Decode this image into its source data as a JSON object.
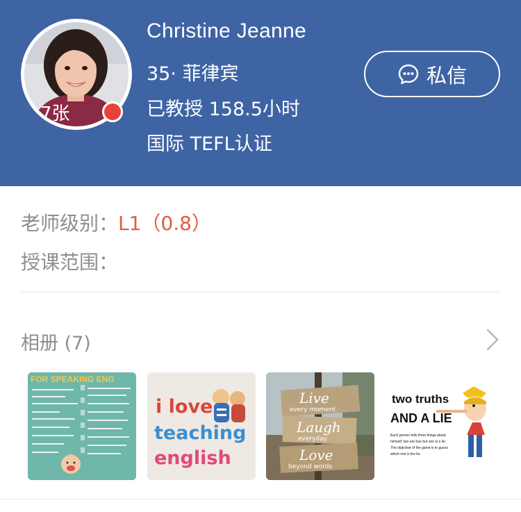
{
  "profile": {
    "name": "Christine Jeanne",
    "photo_count": "7张",
    "age_country": "35· 菲律宾",
    "hours_taught": "已教授 158.5小时",
    "certification": "国际 TEFL认证",
    "message_button": "私信"
  },
  "details": {
    "level_label": "老师级别：",
    "level_value": "L1（0.8）",
    "scope_label": "授课范围："
  },
  "album": {
    "title": "相册 (7)",
    "photos": [
      {
        "name": "speaking-english-poster",
        "banner": "FOR SPEAKING ENG"
      },
      {
        "name": "i-love-teaching-english",
        "line1": "i love",
        "line2": "teaching",
        "line3": "english"
      },
      {
        "name": "live-laugh-love-sign",
        "line1": "Live",
        "line2": "every moment",
        "line3": "Laugh",
        "line4": "everyday",
        "line5": "Love",
        "line6": "beyond words"
      },
      {
        "name": "two-truths-and-a-lie",
        "line1": "two truths",
        "line2": "AND A LIE",
        "caption1": "Each person tells three things about",
        "caption2": "himself; two are true but one is a lie.",
        "caption3": "The objective of the game is to guess",
        "caption4": "which one is the lie."
      }
    ]
  },
  "colors": {
    "header_bg": "#3f64a4",
    "accent": "#e25b3c",
    "online_dot": "#e8433a",
    "muted_text": "#8e8e8e"
  },
  "icons": [
    "message-bubble-icon",
    "chevron-right-icon"
  ]
}
